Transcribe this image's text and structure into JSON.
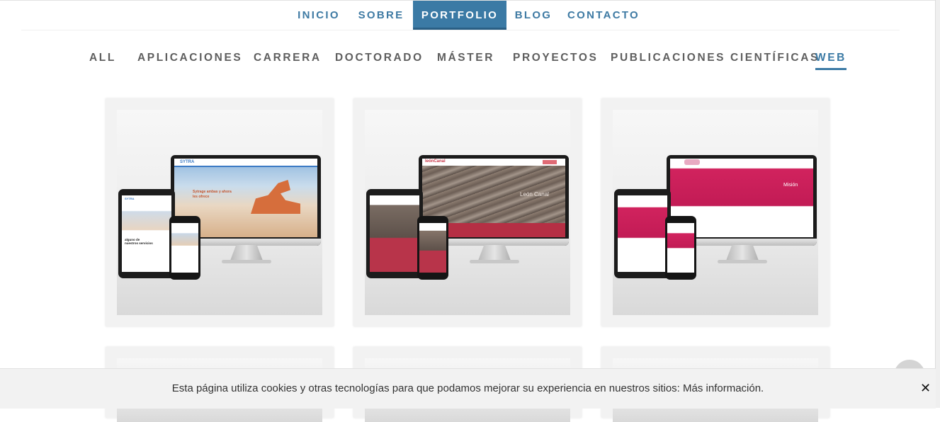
{
  "nav": {
    "items": [
      {
        "label": "INICIO",
        "active": false
      },
      {
        "label": "SOBRE",
        "active": false
      },
      {
        "label": "PORTFOLIO",
        "active": true
      },
      {
        "label": "BLOG",
        "active": false
      },
      {
        "label": "CONTACTO",
        "active": false
      }
    ]
  },
  "filters": {
    "items": [
      {
        "label": "ALL",
        "active": false
      },
      {
        "label": "APLICACIONES",
        "active": false
      },
      {
        "label": "CARRERA",
        "active": false
      },
      {
        "label": "DOCTORADO",
        "active": false
      },
      {
        "label": "MÁSTER",
        "active": false
      },
      {
        "label": "PROYECTOS",
        "active": false
      },
      {
        "label": "PUBLICACIONES CIENTÍFICAS",
        "active": false
      },
      {
        "label": "WEB",
        "active": true
      }
    ]
  },
  "portfolio": {
    "cards": [
      {
        "brand": "SYTRA",
        "headline": "Sytrage ambas y ahora les ofrece",
        "mobile_text": "alguno de nuestros servicios",
        "accent": "#3a79c4"
      },
      {
        "brand": "leónCanal",
        "headline": "León Canal",
        "accent": "#c8394a"
      },
      {
        "brand": "",
        "headline": "Misión",
        "accent": "#d1235e"
      }
    ]
  },
  "cookie": {
    "text": "Esta página utiliza cookies y otras tecnologías para que podamos mejorar su experiencia en nuestros sitios: Más información.",
    "close_icon": "close-icon",
    "close_glyph": "✕"
  },
  "scroll_top": {
    "icon": "chevron-up-icon",
    "glyph": "⌃"
  },
  "colors": {
    "primary": "#3b7aa5",
    "text": "#5f5f5f",
    "cookie_bg": "#f2f2f2"
  }
}
